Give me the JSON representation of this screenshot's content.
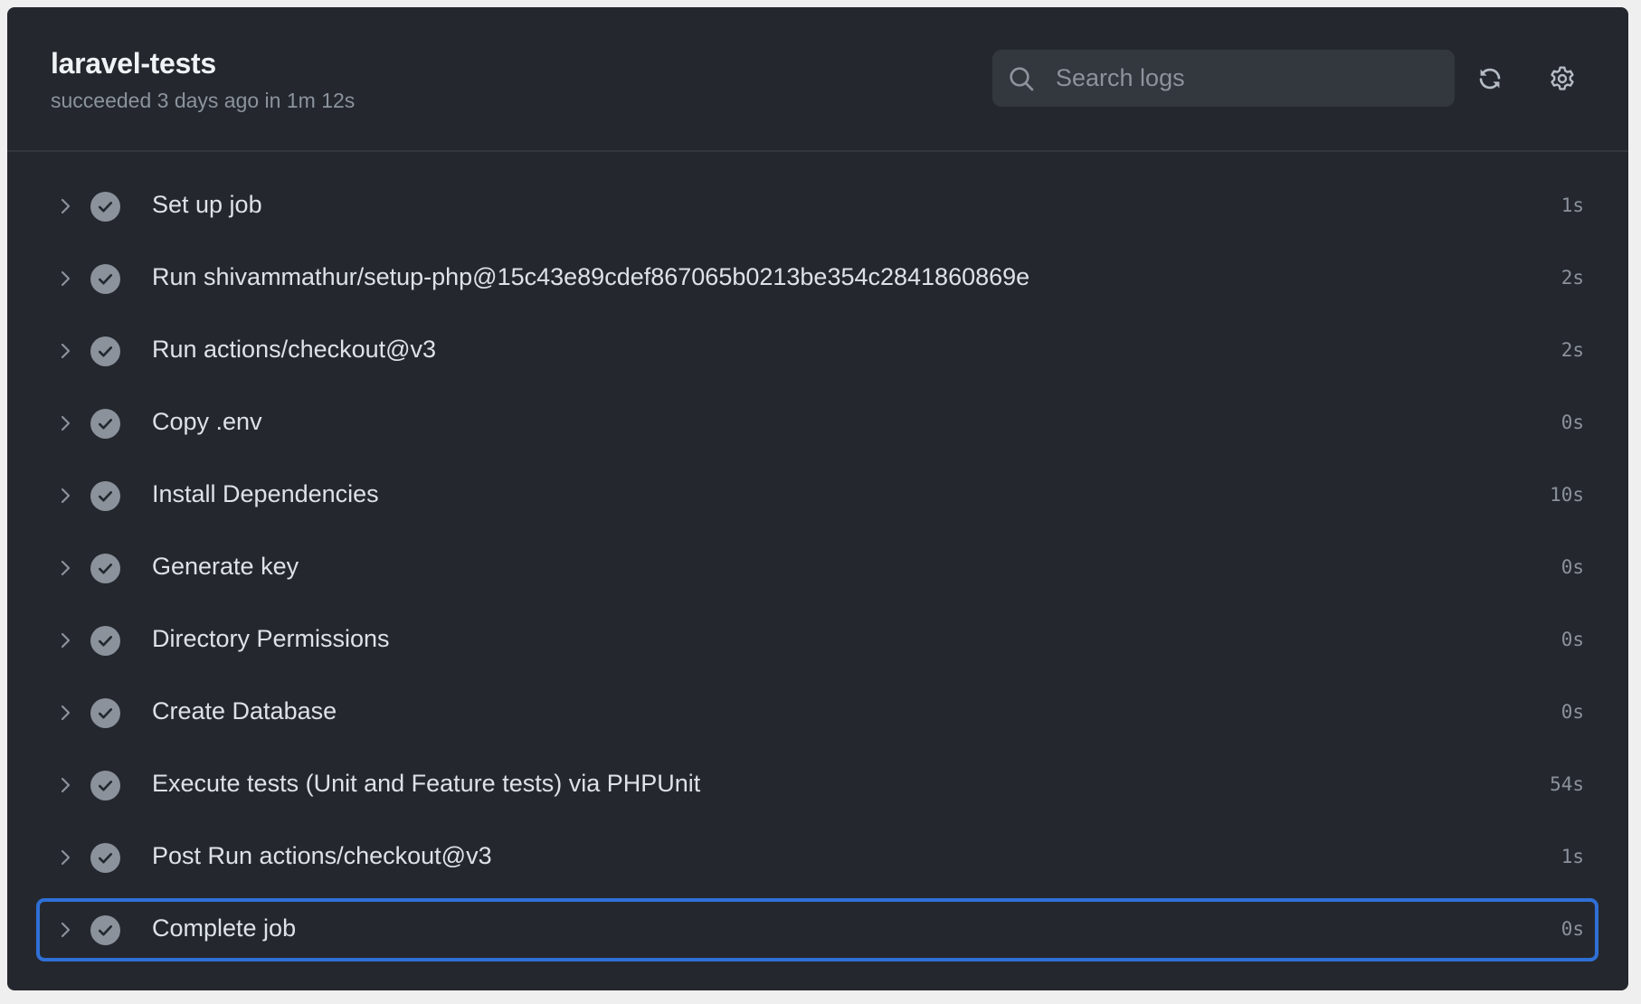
{
  "header": {
    "title": "laravel-tests",
    "subtitle": "succeeded 3 days ago in 1m 12s"
  },
  "search": {
    "placeholder": "Search logs",
    "value": "",
    "icon": "search-icon"
  },
  "toolbar": {
    "refresh_icon": "sync-icon",
    "refresh_label": "Refresh",
    "settings_icon": "gear-icon",
    "settings_label": "Settings"
  },
  "colors": {
    "panel_bg": "#24282e",
    "page_bg": "#efefef",
    "focus_border": "#2f6fd6",
    "success_icon": "#8b929b",
    "text_primary": "#dde2e8",
    "text_muted": "#8b939c"
  },
  "steps": [
    {
      "label": "Set up job",
      "duration": "1s",
      "status": "success",
      "expanded": false,
      "focused": false
    },
    {
      "label": "Run shivammathur/setup-php@15c43e89cdef867065b0213be354c2841860869e",
      "duration": "2s",
      "status": "success",
      "expanded": false,
      "focused": false
    },
    {
      "label": "Run actions/checkout@v3",
      "duration": "2s",
      "status": "success",
      "expanded": false,
      "focused": false
    },
    {
      "label": "Copy .env",
      "duration": "0s",
      "status": "success",
      "expanded": false,
      "focused": false
    },
    {
      "label": "Install Dependencies",
      "duration": "10s",
      "status": "success",
      "expanded": false,
      "focused": false
    },
    {
      "label": "Generate key",
      "duration": "0s",
      "status": "success",
      "expanded": false,
      "focused": false
    },
    {
      "label": "Directory Permissions",
      "duration": "0s",
      "status": "success",
      "expanded": false,
      "focused": false
    },
    {
      "label": "Create Database",
      "duration": "0s",
      "status": "success",
      "expanded": false,
      "focused": false
    },
    {
      "label": "Execute tests (Unit and Feature tests) via PHPUnit",
      "duration": "54s",
      "status": "success",
      "expanded": false,
      "focused": false
    },
    {
      "label": "Post Run actions/checkout@v3",
      "duration": "1s",
      "status": "success",
      "expanded": false,
      "focused": false
    },
    {
      "label": "Complete job",
      "duration": "0s",
      "status": "success",
      "expanded": false,
      "focused": true
    }
  ]
}
